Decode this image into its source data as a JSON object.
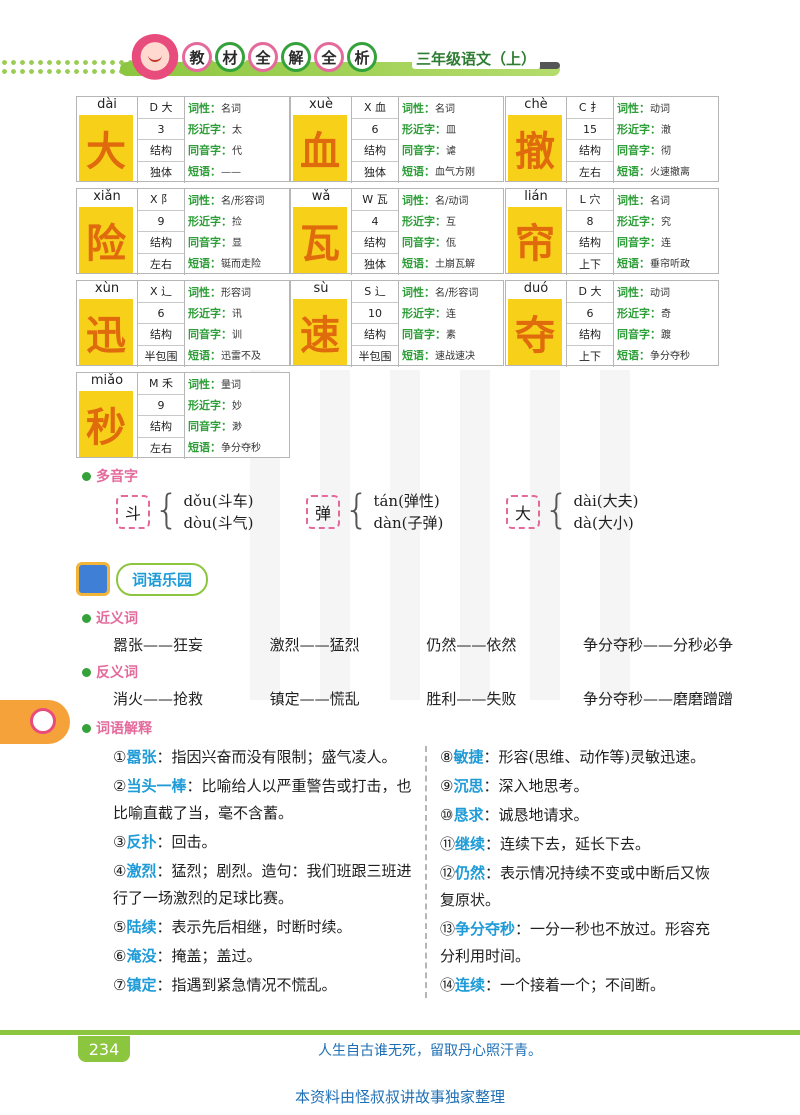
{
  "header": {
    "brand_chars": [
      "教",
      "材",
      "全",
      "解",
      "全",
      "析"
    ],
    "book": "三年级语文（上）"
  },
  "characters": [
    {
      "char": "大",
      "pinyin": "dài",
      "index_letter": "D",
      "radical": "大",
      "strokes": "3",
      "structure": "结构",
      "structure_type": "独体",
      "pos": "名词",
      "similar": "太",
      "homophone": "代",
      "phrase": "——"
    },
    {
      "char": "血",
      "pinyin": "xuè",
      "index_letter": "X",
      "radical": "血",
      "strokes": "6",
      "structure": "结构",
      "structure_type": "独体",
      "pos": "名词",
      "similar": "皿",
      "homophone": "谑",
      "phrase": "血气方刚"
    },
    {
      "char": "撤",
      "pinyin": "chè",
      "index_letter": "C",
      "radical": "扌",
      "strokes": "15",
      "structure": "结构",
      "structure_type": "左右",
      "pos": "动词",
      "similar": "澈",
      "homophone": "彻",
      "phrase": "火速撤离"
    },
    {
      "char": "险",
      "pinyin": "xiǎn",
      "index_letter": "X",
      "radical": "阝",
      "strokes": "9",
      "structure": "结构",
      "structure_type": "左右",
      "pos": "名/形容词",
      "similar": "捡",
      "homophone": "显",
      "phrase": "铤而走险"
    },
    {
      "char": "瓦",
      "pinyin": "wǎ",
      "index_letter": "W",
      "radical": "瓦",
      "strokes": "4",
      "structure": "结构",
      "structure_type": "独体",
      "pos": "名/动词",
      "similar": "互",
      "homophone": "佤",
      "phrase": "土崩瓦解"
    },
    {
      "char": "帘",
      "pinyin": "lián",
      "index_letter": "L",
      "radical": "穴",
      "strokes": "8",
      "structure": "结构",
      "structure_type": "上下",
      "pos": "名词",
      "similar": "究",
      "homophone": "连",
      "phrase": "垂帘听政"
    },
    {
      "char": "迅",
      "pinyin": "xùn",
      "index_letter": "X",
      "radical": "辶",
      "strokes": "6",
      "structure": "结构",
      "structure_type": "半包围",
      "pos": "形容词",
      "similar": "讯",
      "homophone": "训",
      "phrase": "迅雷不及"
    },
    {
      "char": "速",
      "pinyin": "sù",
      "index_letter": "S",
      "radical": "辶",
      "strokes": "10",
      "structure": "结构",
      "structure_type": "半包围",
      "pos": "名/形容词",
      "similar": "连",
      "homophone": "素",
      "phrase": "速战速决"
    },
    {
      "char": "夺",
      "pinyin": "duó",
      "index_letter": "D",
      "radical": "大",
      "strokes": "6",
      "structure": "结构",
      "structure_type": "上下",
      "pos": "动词",
      "similar": "奇",
      "homophone": "踱",
      "phrase": "争分夺秒"
    },
    {
      "char": "秒",
      "pinyin": "miǎo",
      "index_letter": "M",
      "radical": "禾",
      "strokes": "9",
      "structure": "结构",
      "structure_type": "左右",
      "pos": "量词",
      "similar": "妙",
      "homophone": "渺",
      "phrase": "争分夺秒"
    }
  ],
  "labels": {
    "pos": "词性：",
    "similar": "形近字：",
    "homophone": "同音字：",
    "phrase": "短语："
  },
  "polyphones": {
    "title": "多音字",
    "items": [
      {
        "char": "斗",
        "r1": "dǒu(斗车)",
        "r2": "dòu(斗气)"
      },
      {
        "char": "弹",
        "r1": "tán(弹性)",
        "r2": "dàn(子弹)"
      },
      {
        "char": "大",
        "r1": "dài(大夫)",
        "r2": "dà(大小)"
      }
    ]
  },
  "fun": {
    "title": "词语乐园"
  },
  "synonyms": {
    "title": "近义词",
    "pairs": [
      "嚣张——狂妄",
      "激烈——猛烈",
      "仍然——依然",
      "争分夺秒——分秒必争"
    ]
  },
  "antonyms": {
    "title": "反义词",
    "pairs": [
      "消火——抢救",
      "镇定——慌乱",
      "胜利——失败",
      "争分夺秒——磨磨蹭蹭"
    ]
  },
  "definitions": {
    "title": "词语解释",
    "left": [
      {
        "n": "①",
        "t": "嚣张",
        "d": "：指因兴奋而没有限制；盛气凌人。"
      },
      {
        "n": "②",
        "t": "当头一棒",
        "d": "：比喻给人以严重警告或打击，也比喻直截了当，毫不含蓄。"
      },
      {
        "n": "③",
        "t": "反扑",
        "d": "：回击。"
      },
      {
        "n": "④",
        "t": "激烈",
        "d": "：猛烈；剧烈。造句：我们班跟三班进行了一场激烈的足球比赛。"
      },
      {
        "n": "⑤",
        "t": "陆续",
        "d": "：表示先后相继，时断时续。"
      },
      {
        "n": "⑥",
        "t": "淹没",
        "d": "：掩盖；盖过。"
      },
      {
        "n": "⑦",
        "t": "镇定",
        "d": "：指遇到紧急情况不慌乱。"
      }
    ],
    "right": [
      {
        "n": "⑧",
        "t": "敏捷",
        "d": "：形容(思维、动作等)灵敏迅速。"
      },
      {
        "n": "⑨",
        "t": "沉思",
        "d": "：深入地思考。"
      },
      {
        "n": "⑩",
        "t": "恳求",
        "d": "：诚恳地请求。"
      },
      {
        "n": "⑪",
        "t": "继续",
        "d": "：连续下去，延长下去。"
      },
      {
        "n": "⑫",
        "t": "仍然",
        "d": "：表示情况持续不变或中断后又恢复原状。"
      },
      {
        "n": "⑬",
        "t": "争分夺秒",
        "d": "：一分一秒也不放过。形容充分利用时间。"
      },
      {
        "n": "⑭",
        "t": "连续",
        "d": "：一个接着一个；不间断。"
      }
    ]
  },
  "footer": {
    "page": "234",
    "quote": "人生自古谁无死，留取丹心照汗青。",
    "credit": "本资料由怪叔叔讲故事独家整理"
  }
}
